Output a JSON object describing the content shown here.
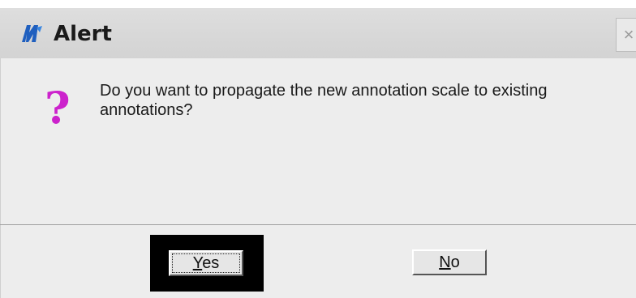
{
  "window": {
    "title": "Alert",
    "close_glyph": "×"
  },
  "icons": {
    "app_icon": "microstation-icon",
    "question_icon": "question-mark-icon",
    "question_glyph": "?",
    "question_color": "#cc22cc"
  },
  "message": {
    "text": "Do you want to propagate the new annotation scale to existing annotations?"
  },
  "buttons": {
    "yes": {
      "accel": "Y",
      "rest": "es"
    },
    "no": {
      "accel": "N",
      "rest": "o"
    }
  }
}
